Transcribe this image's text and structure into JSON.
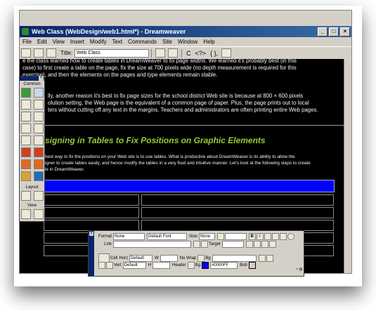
{
  "window": {
    "title": "Web Class (WebDesign/web1.html*) - Dreamweaver",
    "minimize": "_",
    "maximize": "□",
    "close": "×"
  },
  "menu": [
    "File",
    "Edit",
    "View",
    "Insert",
    "Modify",
    "Text",
    "Commands",
    "Site",
    "Window",
    "Help"
  ],
  "toolbar": {
    "title_label": "Title:",
    "title_value": "Web Class",
    "glyphs": [
      "C",
      "<?>",
      "{ },"
    ]
  },
  "document": {
    "para1_lines": [
      "e the class learned how to create tables in DreamWeaver to fix page widths. We learned it's probably best (in this",
      "case) to first create a table on the page, fix the size at 700 pixels wide (no depth measurement is required for this",
      "exercise), and then the elements on the pages and type elements remain stable."
    ],
    "para2_lines": [
      "lly, another reason it's best to fix page sizes for the school district Web site is because at 800 × 600 pixels",
      "olution setting, the Web page is the equivalent of a common page of paper. Plus, the page prints out to local",
      "ters without cutting off any text in the margins. Teachers and administrators are often printing entire Web pages."
    ],
    "heading": "signing in Tables to Fix Positions on Graphic Elements",
    "para3_lines": [
      "best way to fix the positions on your Web site is to use tables. What is productive about DreamWeaver is its ability to allow the",
      "igner to create tables easily, and hence modify the tables in a very fluid and intuitive manner. Let's look at the following steps to create",
      "le in DreamWeaver."
    ]
  },
  "insert_panel": {
    "close": "×",
    "tab": "Common",
    "layout_label": "Layout",
    "view_label": "View"
  },
  "properties": {
    "close": "×",
    "format_label": "Format",
    "format_value": "None",
    "font_value": "Default Font",
    "size_label": "Size",
    "size_value": "None",
    "bold": "B",
    "italic": "I",
    "link_label": "Link",
    "target_label": "Target",
    "cell_label": "Cell",
    "horz_label": "Horz",
    "horz_value": "Default",
    "w_label": "W",
    "nowrap_label": "No Wrap",
    "bg_label": "Bg",
    "vert_label": "Vert",
    "vert_value": "Default",
    "h_label": "H",
    "header_label": "Header",
    "bg2_label": "Bg",
    "bg_color_value": "#0000FF",
    "brdr_label": "Brdr"
  },
  "colors": {
    "heading": "#99cc33",
    "table_header_row": "#0000ff",
    "title_bar": "#0a246a"
  }
}
